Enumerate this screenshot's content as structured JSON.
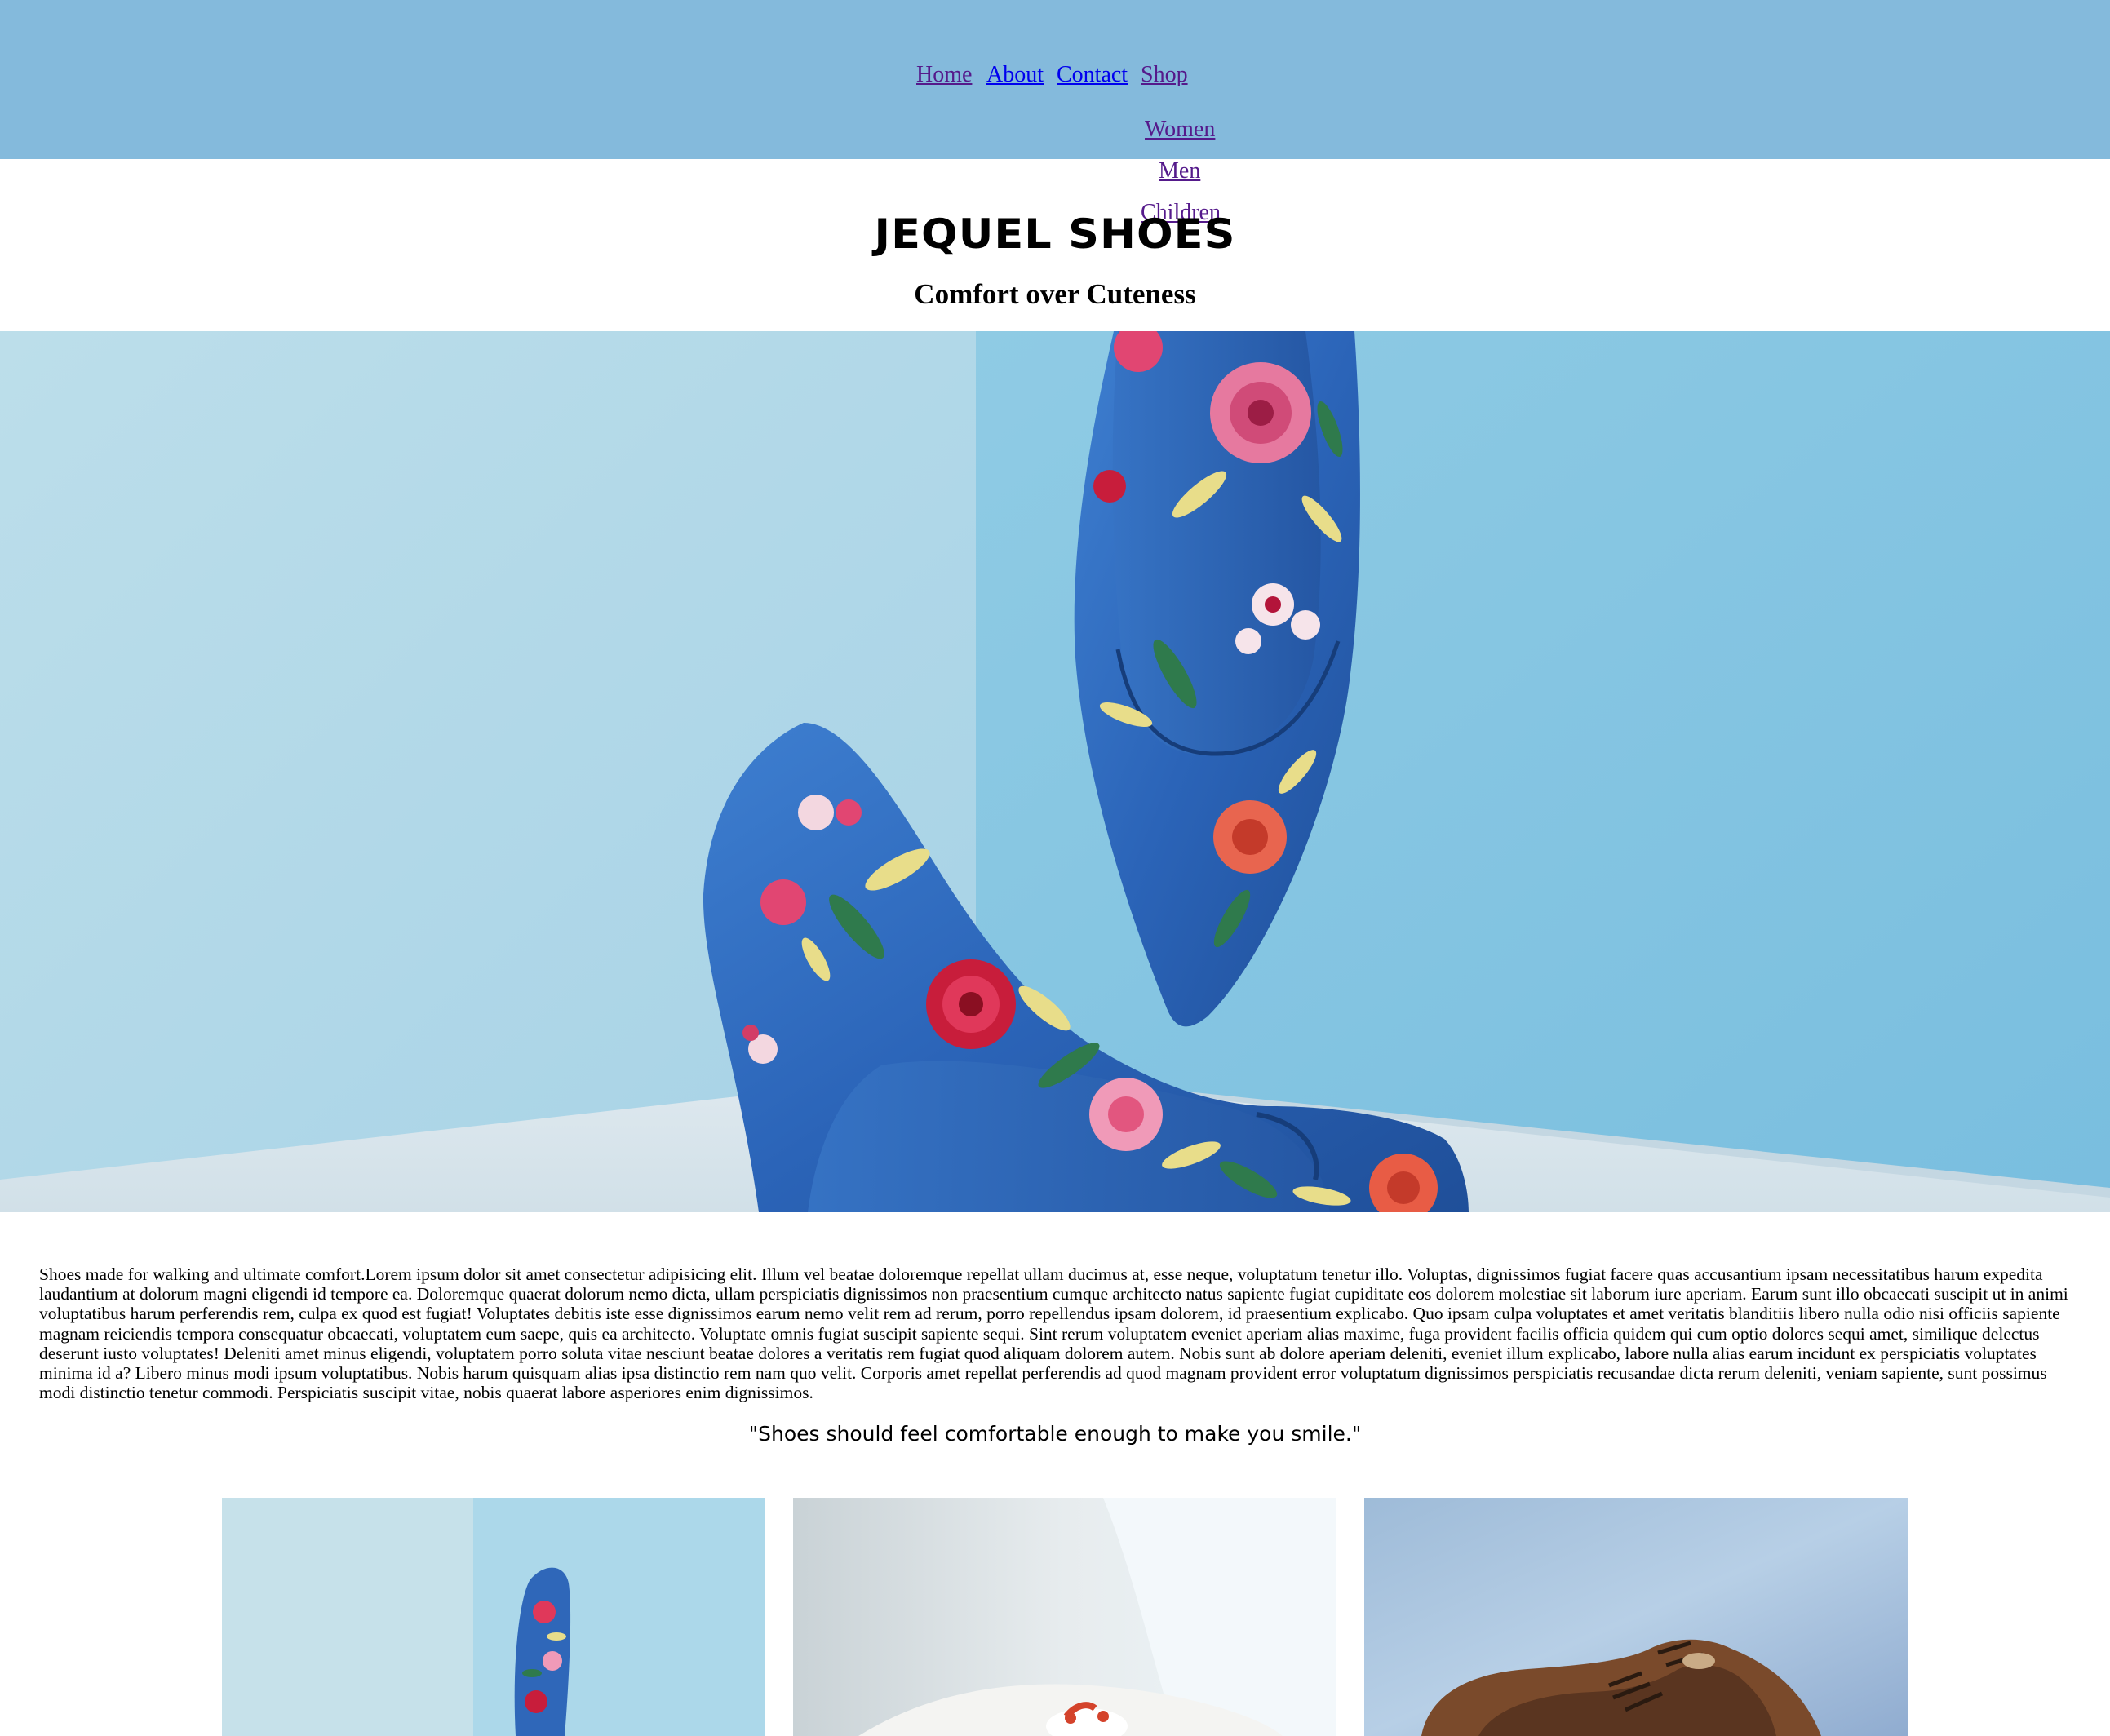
{
  "nav": {
    "items": [
      {
        "label": "Home"
      },
      {
        "label": "About"
      },
      {
        "label": "Contact"
      },
      {
        "label": "Shop"
      }
    ],
    "shop_submenu": [
      {
        "label": "Women"
      },
      {
        "label": "Men"
      },
      {
        "label": "Children"
      }
    ]
  },
  "header": {
    "brand": "JEQUEL SHOES",
    "tagline": "Comfort over Cuteness"
  },
  "hero": {
    "image": "floral-stiletto-heels-photo"
  },
  "content": {
    "intro": "Shoes made for walking and ultimate comfort.Lorem ipsum dolor sit amet consectetur adipisicing elit. Illum vel beatae doloremque repellat ullam ducimus at, esse neque, voluptatum tenetur illo. Voluptas, dignissimos fugiat facere quas accusantium ipsam necessitatibus harum expedita laudantium at dolorum magni eligendi id tempore ea. Doloremque quaerat dolorum nemo dicta, ullam perspiciatis dignissimos non praesentium cumque architecto natus sapiente fugiat cupiditate eos dolorem molestiae sit laborum iure aperiam. Earum sunt illo obcaecati suscipit ut in animi voluptatibus harum perferendis rem, culpa ex quod est fugiat! Voluptates debitis iste esse dignissimos earum nemo velit rem ad rerum, porro repellendus ipsam dolorem, id praesentium explicabo. Quo ipsam culpa voluptates et amet veritatis blanditiis libero nulla odio nisi officiis sapiente magnam reiciendis tempora consequatur obcaecati, voluptatem eum saepe, quis ea architecto. Voluptate omnis fugiat suscipit sapiente sequi. Sint rerum voluptatem eveniet aperiam alias maxime, fuga provident facilis officia quidem qui cum optio dolores sequi amet, similique delectus deserunt iusto voluptates! Deleniti amet minus eligendi, voluptatem porro soluta vitae nesciunt beatae dolores a veritatis rem fugiat quod aliquam dolorem autem. Nobis sunt ab dolore aperiam deleniti, eveniet illum explicabo, labore nulla alias earum incidunt ex perspiciatis voluptates minima id a? Libero minus modi ipsum voluptatibus. Nobis harum quisquam alias ipsa distinctio rem nam quo velit. Corporis amet repellat perferendis ad quod magnam provident error voluptatum dignissimos perspiciatis recusandae dicta rerum deleniti, veniam sapiente, sunt possimus modi distinctio tenetur commodi. Perspiciatis suscipit vitae, nobis quaerat labore asperiores enim dignissimos.",
    "quote": "\"Shoes should feel comfortable enough to make you smile.\""
  },
  "gallery": [
    {
      "image": "floral-heel-photo"
    },
    {
      "image": "white-sneakers-photo"
    },
    {
      "image": "brown-leather-shoes-photo"
    }
  ],
  "colors": {
    "header_bg": "#84badc",
    "link_visited": "#551a8b",
    "link_unvisited": "#0000ee",
    "hero_wall": "#8ec7e0"
  }
}
